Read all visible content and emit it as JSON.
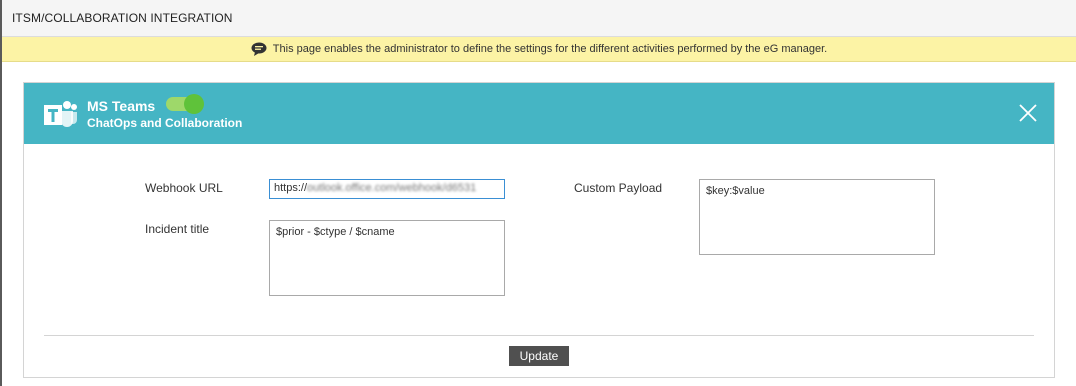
{
  "header": {
    "title": "ITSM/COLLABORATION INTEGRATION"
  },
  "notice": {
    "icon": "speech-bubble-icon",
    "text": "This page enables the administrator to define the settings for the different activities performed by the eG manager."
  },
  "card": {
    "app_name": "MS Teams",
    "subtitle": "ChatOps and Collaboration",
    "icon": "ms-teams-icon",
    "toggle_state": "on",
    "close_icon": "close-icon",
    "accent_color": "#45b5c4"
  },
  "form": {
    "webhook_label": "Webhook URL",
    "webhook_value_prefix": "https://",
    "webhook_value_obscured": "outlook.office.com/webhook/d6531",
    "incident_title_label": "Incident title",
    "incident_title_value": "$prior - $ctype / $cname",
    "custom_payload_label": "Custom Payload",
    "custom_payload_value": "$key:$value"
  },
  "actions": {
    "update_label": "Update"
  }
}
